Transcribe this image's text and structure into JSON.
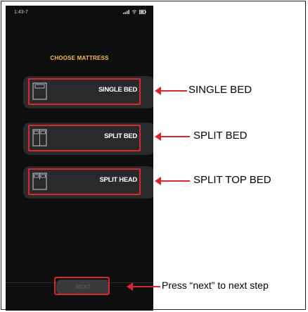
{
  "status_bar": {
    "time": "1:43-7",
    "icons": [
      "signal-icon",
      "wifi-icon",
      "battery-icon"
    ]
  },
  "screen_title": "CHOOSE MATTRESS",
  "options": [
    {
      "label": "SINGLE BED",
      "icon": "single-bed-icon"
    },
    {
      "label": "SPLIT BED",
      "icon": "split-bed-icon"
    },
    {
      "label": "SPLIT HEAD",
      "icon": "split-head-bed-icon"
    }
  ],
  "next_button": {
    "label": "NEXT"
  },
  "callouts": {
    "single": "SINGLE BED",
    "split": "SPLIT BED",
    "split_top": "SPLIT TOP BED",
    "next": "Press “next” to next step"
  },
  "colors": {
    "highlight": "#d8282e",
    "title": "#f0c24a",
    "card": "#2a2a2c",
    "screen": "#0e0e0e"
  }
}
